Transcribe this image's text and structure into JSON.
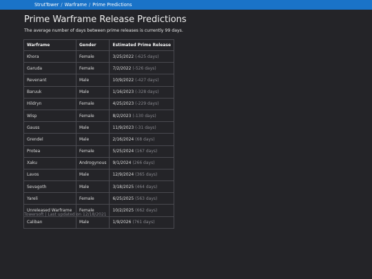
{
  "breadcrumb": {
    "items": [
      "StrutTower",
      "Warframe",
      "Prime Predictions"
    ],
    "separator": "/"
  },
  "header": {
    "title": "Prime Warframe Release Predictions",
    "subtitle": "The average number of days between prime releases is currently 99 days."
  },
  "table": {
    "columns": [
      "Warframe",
      "Gender",
      "Estimated Prime Release"
    ],
    "rows": [
      {
        "warframe": "Khora",
        "gender": "Female",
        "date": "3/25/2022",
        "delta": "(-625 days)"
      },
      {
        "warframe": "Garuda",
        "gender": "Female",
        "date": "7/2/2022",
        "delta": "(-526 days)"
      },
      {
        "warframe": "Revenant",
        "gender": "Male",
        "date": "10/9/2022",
        "delta": "(-427 days)"
      },
      {
        "warframe": "Baruuk",
        "gender": "Male",
        "date": "1/16/2023",
        "delta": "(-328 days)"
      },
      {
        "warframe": "Hildryn",
        "gender": "Female",
        "date": "4/25/2023",
        "delta": "(-229 days)"
      },
      {
        "warframe": "Wisp",
        "gender": "Female",
        "date": "8/2/2023",
        "delta": "(-130 days)"
      },
      {
        "warframe": "Gauss",
        "gender": "Male",
        "date": "11/9/2023",
        "delta": "(-31 days)"
      },
      {
        "warframe": "Grendel",
        "gender": "Male",
        "date": "2/16/2024",
        "delta": "(68 days)"
      },
      {
        "warframe": "Protea",
        "gender": "Female",
        "date": "5/25/2024",
        "delta": "(167 days)"
      },
      {
        "warframe": "Xaku",
        "gender": "Androgynous",
        "date": "9/1/2024",
        "delta": "(266 days)"
      },
      {
        "warframe": "Lavos",
        "gender": "Male",
        "date": "12/9/2024",
        "delta": "(365 days)"
      },
      {
        "warframe": "Sevagoth",
        "gender": "Male",
        "date": "3/18/2025",
        "delta": "(464 days)"
      },
      {
        "warframe": "Yareli",
        "gender": "Female",
        "date": "6/25/2025",
        "delta": "(563 days)"
      },
      {
        "warframe": "Unreleased Warframe",
        "gender": "Female",
        "date": "10/2/2025",
        "delta": "(662 days)"
      },
      {
        "warframe": "Caliban",
        "gender": "Male",
        "date": "1/9/2026",
        "delta": "(761 days)"
      }
    ]
  },
  "footer": {
    "text": "Towersoft | Last updated on 12/18/2021"
  },
  "colors": {
    "topbar": "#1a73c8",
    "background": "#242428",
    "muted": "#8a8a90"
  }
}
